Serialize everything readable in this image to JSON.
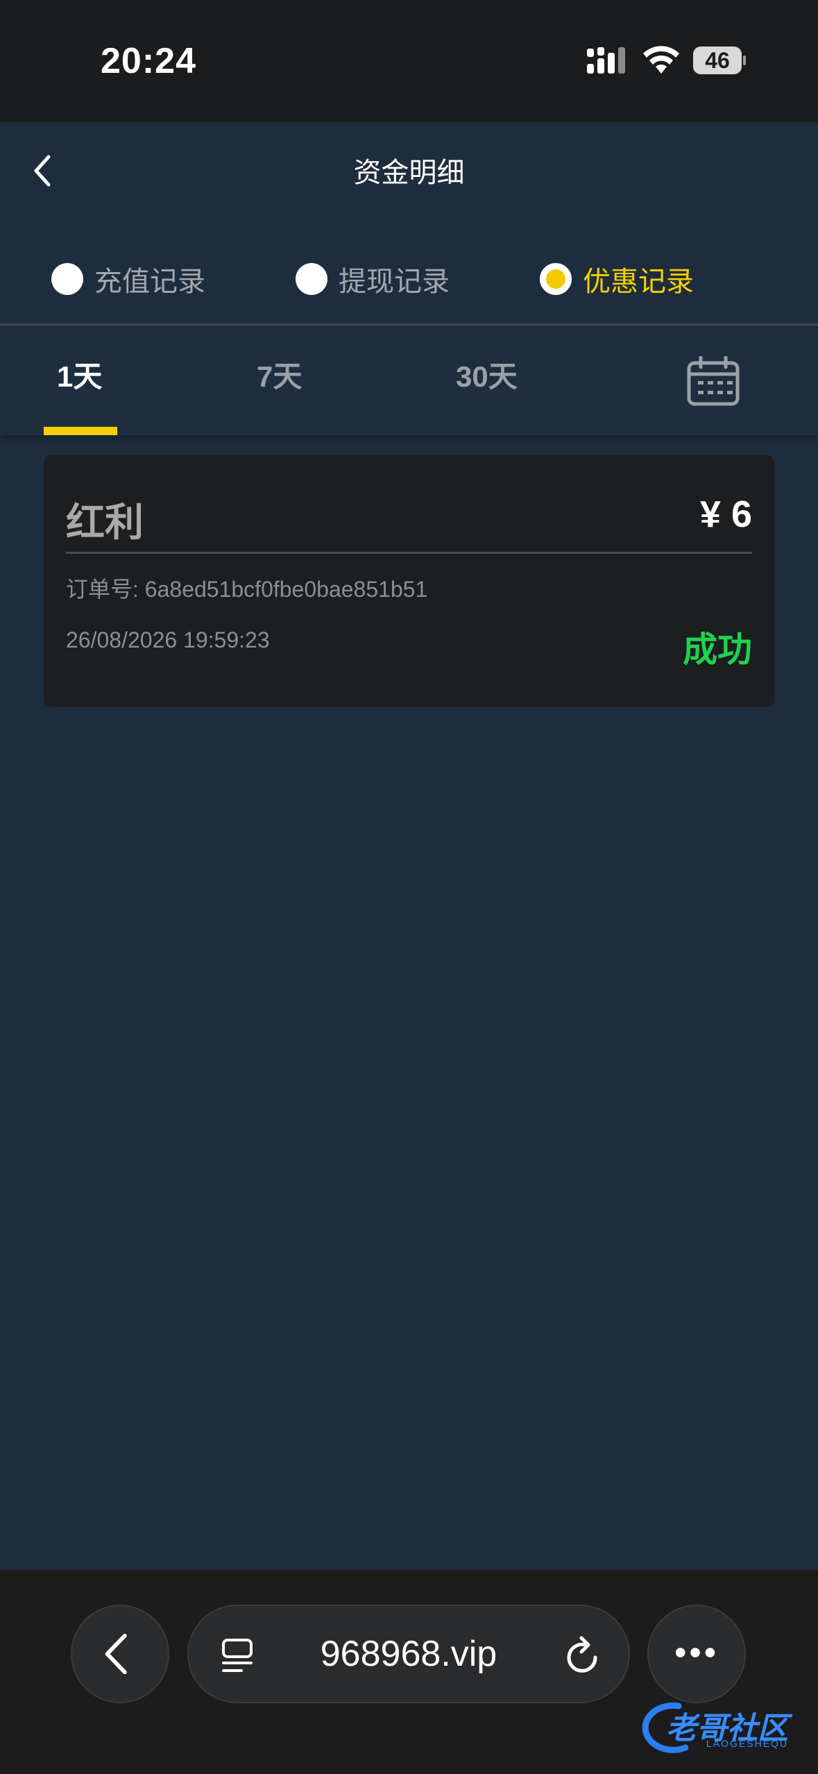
{
  "status_bar": {
    "time": "20:24",
    "battery": "46"
  },
  "header": {
    "title": "资金明细"
  },
  "record_types": [
    {
      "label": "充值记录",
      "selected": false
    },
    {
      "label": "提现记录",
      "selected": false
    },
    {
      "label": "优惠记录",
      "selected": true
    }
  ],
  "range_tabs": [
    {
      "label": "1天",
      "active": true
    },
    {
      "label": "7天",
      "active": false
    },
    {
      "label": "30天",
      "active": false
    }
  ],
  "records": [
    {
      "type": "红利",
      "amount": "¥ 6",
      "order_label": "订单号: ",
      "order_id": "6a8ed51bcf0fbe0bae851b51",
      "datetime": "26/08/2026 19:59:23",
      "status": "成功"
    }
  ],
  "browser": {
    "url": "968968.vip"
  },
  "watermark": {
    "text": "老哥社区",
    "subtext": "LAOGESHEQU"
  },
  "colors": {
    "accent": "#f5d000",
    "success": "#1fd34e",
    "background": "#1e2d3d"
  },
  "icons": [
    "back-chevron-icon",
    "calendar-icon",
    "tabs-icon",
    "reload-icon",
    "more-icon"
  ]
}
